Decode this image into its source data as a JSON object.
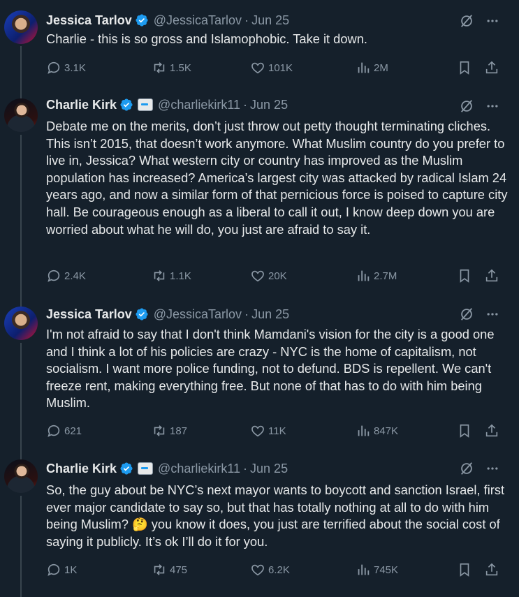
{
  "tweets": [
    {
      "name": "Jessica Tarlov",
      "handle": "@JessicaTarlov",
      "date": "Jun 25",
      "affiliate": false,
      "text": "Charlie - this is so gross and Islamophobic. Take it down.",
      "replies": "3.1K",
      "retweets": "1.5K",
      "likes": "101K",
      "views": "2M"
    },
    {
      "name": "Charlie Kirk",
      "handle": "@charliekirk11",
      "date": "Jun 25",
      "affiliate": true,
      "text": "Debate me on the merits, don’t just throw out petty thought terminating cliches. This isn’t 2015, that doesn’t work anymore. What Muslim country do you prefer to live in, Jessica? What western city or country has improved as the Muslim population has increased? America’s largest city was attacked by radical Islam 24 years ago, and now a similar form of that pernicious force is poised to capture city hall. Be courageous enough as a liberal to call it out, I know deep down you are worried about what he will do, you just are afraid to say it.",
      "replies": "2.4K",
      "retweets": "1.1K",
      "likes": "20K",
      "views": "2.7M"
    },
    {
      "name": "Jessica Tarlov",
      "handle": "@JessicaTarlov",
      "date": "Jun 25",
      "affiliate": false,
      "text": "I'm not afraid to say that I don't think Mamdani's vision for the city is a good one and I think a lot of his policies are crazy - NYC is the home of capitalism, not socialism. I want more police funding, not to defund. BDS is repellent. We can't freeze rent, making everything free. But none of that has to do with him being Muslim.",
      "replies": "621",
      "retweets": "187",
      "likes": "11K",
      "views": "847K"
    },
    {
      "name": "Charlie Kirk",
      "handle": "@charliekirk11",
      "date": "Jun 25",
      "affiliate": true,
      "text": "So, the guy about be NYC’s next mayor wants to boycott and sanction Israel, first ever major candidate to say so, but that has totally nothing at all to do with him being Muslim? 🤔 you know it does, you just are terrified about the social cost of saying it publicly. It’s ok I’ll do it for you.",
      "replies": "1K",
      "retweets": "475",
      "likes": "6.2K",
      "views": "745K"
    }
  ],
  "colors": {
    "background": "#15202b",
    "text": "#e7e9ea",
    "muted": "#8b98a5",
    "verified": "#1d9bf0"
  },
  "icons": [
    "verified-badge-icon",
    "grok-icon",
    "more-icon",
    "reply-icon",
    "retweet-icon",
    "like-icon",
    "views-icon",
    "bookmark-icon",
    "share-icon"
  ]
}
